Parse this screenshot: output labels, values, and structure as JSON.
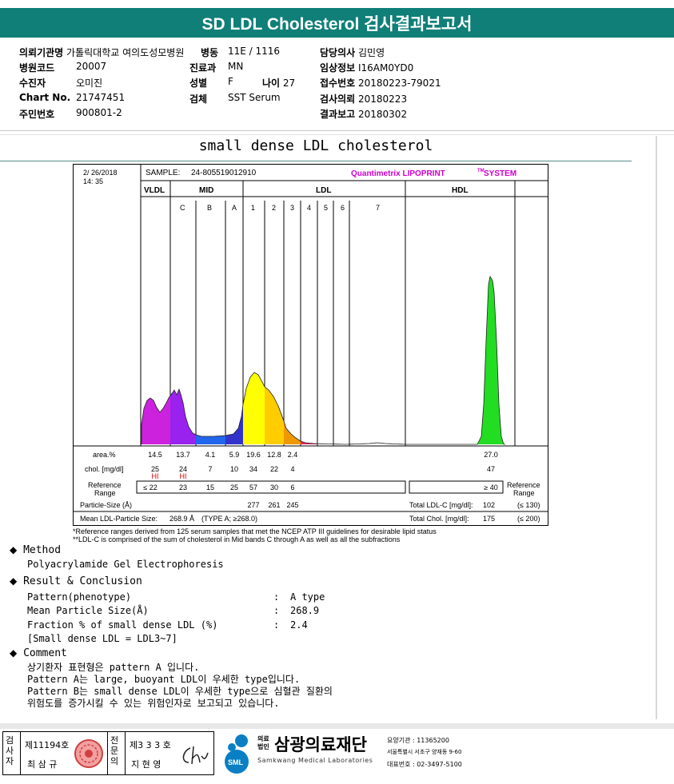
{
  "report_title": "SD LDL Cholesterol 검사결과보고서",
  "patient_info": {
    "institution_label": "의뢰기관명",
    "institution_value": "가톨릭대학교 여의도성모병원",
    "ward_label": "병동",
    "ward_value": "11E / 1116",
    "doctor_label": "담당의사",
    "doctor_value": "김민영",
    "hospcode_label": "병원코드",
    "hospcode_value": "20007",
    "dept_label": "진료과",
    "dept_value": "MN",
    "clinical_label": "임상정보",
    "clinical_value": "I16AM0YD0",
    "patient_label": "수진자",
    "patient_value": "오미진",
    "sex_label": "성별",
    "sex_value": "F",
    "age_label": "나이",
    "age_value": "27",
    "receipt_label": "접수번호",
    "receipt_value": "20180223-79021",
    "chart_label": "Chart No.",
    "chart_value": "21747451",
    "specimen_label": "검체",
    "specimen_value": "SST Serum",
    "request_label": "검사의뢰",
    "request_value": "20180223",
    "id_label": "주민번호",
    "id_value": "900801-2",
    "report_label": "결과보고",
    "report_value": "20180302"
  },
  "section_title": "small dense LDL cholesterol",
  "chart_data": {
    "type": "area",
    "date": "2/ 26/2018",
    "time": "14: 35",
    "sample_label": "SAMPLE:",
    "sample_id": "24-805519012910",
    "system_name": "Quantimetrix LIPOPRINT",
    "system_tm": "TM",
    "system_suffix": "SYSTEM",
    "band_groups": [
      "VLDL",
      "MID",
      "LDL",
      "HDL"
    ],
    "mid_bands": [
      "C",
      "B",
      "A"
    ],
    "ldl_bands": [
      "1",
      "2",
      "3",
      "4",
      "5",
      "6",
      "7"
    ],
    "area_label": "area.%",
    "area_values": [
      "14.5",
      "13.7",
      "4.1",
      "5.9",
      "19.6",
      "12.8",
      "2.4",
      "27.0"
    ],
    "chol_label": "chol. [mg/dl]",
    "chol_values": [
      "25",
      "24",
      "7",
      "10",
      "34",
      "22",
      "4",
      "47"
    ],
    "hi_flags": [
      "HI",
      "HI"
    ],
    "ref_label_1": "Reference",
    "ref_label_2": "Range",
    "ref_values": [
      "≤ 22",
      "23",
      "15",
      "25",
      "57",
      "30",
      "6",
      "≥ 40"
    ],
    "particle_label": "Particle-Size (Å)",
    "particle_values": [
      "277",
      "261",
      "245"
    ],
    "mean_label": "Mean LDL-Particle Size:",
    "mean_value": "268.9 Å",
    "mean_type": "(TYPE A; ≥268.0)",
    "total_ldl_label": "Total LDL-C [mg/dl]:",
    "total_ldl_value": "102",
    "total_ldl_ref": "(≤ 130)",
    "total_chol_label": "Total Chol. [mg/dl]:",
    "total_chol_value": "175",
    "total_chol_ref": "(≤ 200)",
    "colors": {
      "vldl": "#cc22dd",
      "mid_c": "#9922ee",
      "mid_b": "#2266ee",
      "mid_a": "#3333cc",
      "ldl1": "#ffff00",
      "ldl2": "#ffcc00",
      "ldl3": "#ee9900",
      "ldl4": "#ee2266",
      "hdl": "#22dd22",
      "system": "#cc00cc",
      "hi": "#dd0000"
    }
  },
  "footnotes": [
    "*Reference ranges derived from 125 serum samples that met the NCEP ATP III guidelines for desirable lipid status",
    "**LDL-C is comprised of the sum of cholesterol in Mid bands C through A as well as all the subfractions"
  ],
  "method": {
    "heading": "Method",
    "text": "Polyacrylamide Gel Electrophoresis"
  },
  "result": {
    "heading": "Result & Conclusion",
    "rows": [
      {
        "label": "Pattern(phenotype)",
        "value": "A type"
      },
      {
        "label": "Mean Particle Size(Å)",
        "value": "268.9"
      },
      {
        "label": "Fraction % of small dense LDL (%)",
        "value": "2.4"
      }
    ],
    "note": "[Small dense LDL = LDL3~7]"
  },
  "comment": {
    "heading": "Comment",
    "lines": [
      "상기환자 표현형은 pattern A 입니다.",
      "Pattern A는 large, buoyant LDL이 우세한 type입니다.",
      "Pattern B는 small dense LDL이 우세한 type으로 심혈관 질환의",
      "위험도를 증가시킬 수 있는 위험인자로 보고되고 있습니다."
    ]
  },
  "footer": {
    "left_label": "검사자",
    "left_no": "제11194호",
    "left_name": "최 삼 규",
    "mid_label": "전문의",
    "mid_no": "제3 3 3 호",
    "mid_name": "지 현 영",
    "org_small_1": "의료",
    "org_small_2": "법인",
    "org_name": "삼광의료재단",
    "org_en": "Samkwang Medical Laboratories",
    "logo_text": "SML",
    "inst_code": "요양기관 : 11365200",
    "address": "서울특별시 서초구 양재동 9-60",
    "phone": "대표번호 : 02-3497-5100"
  }
}
